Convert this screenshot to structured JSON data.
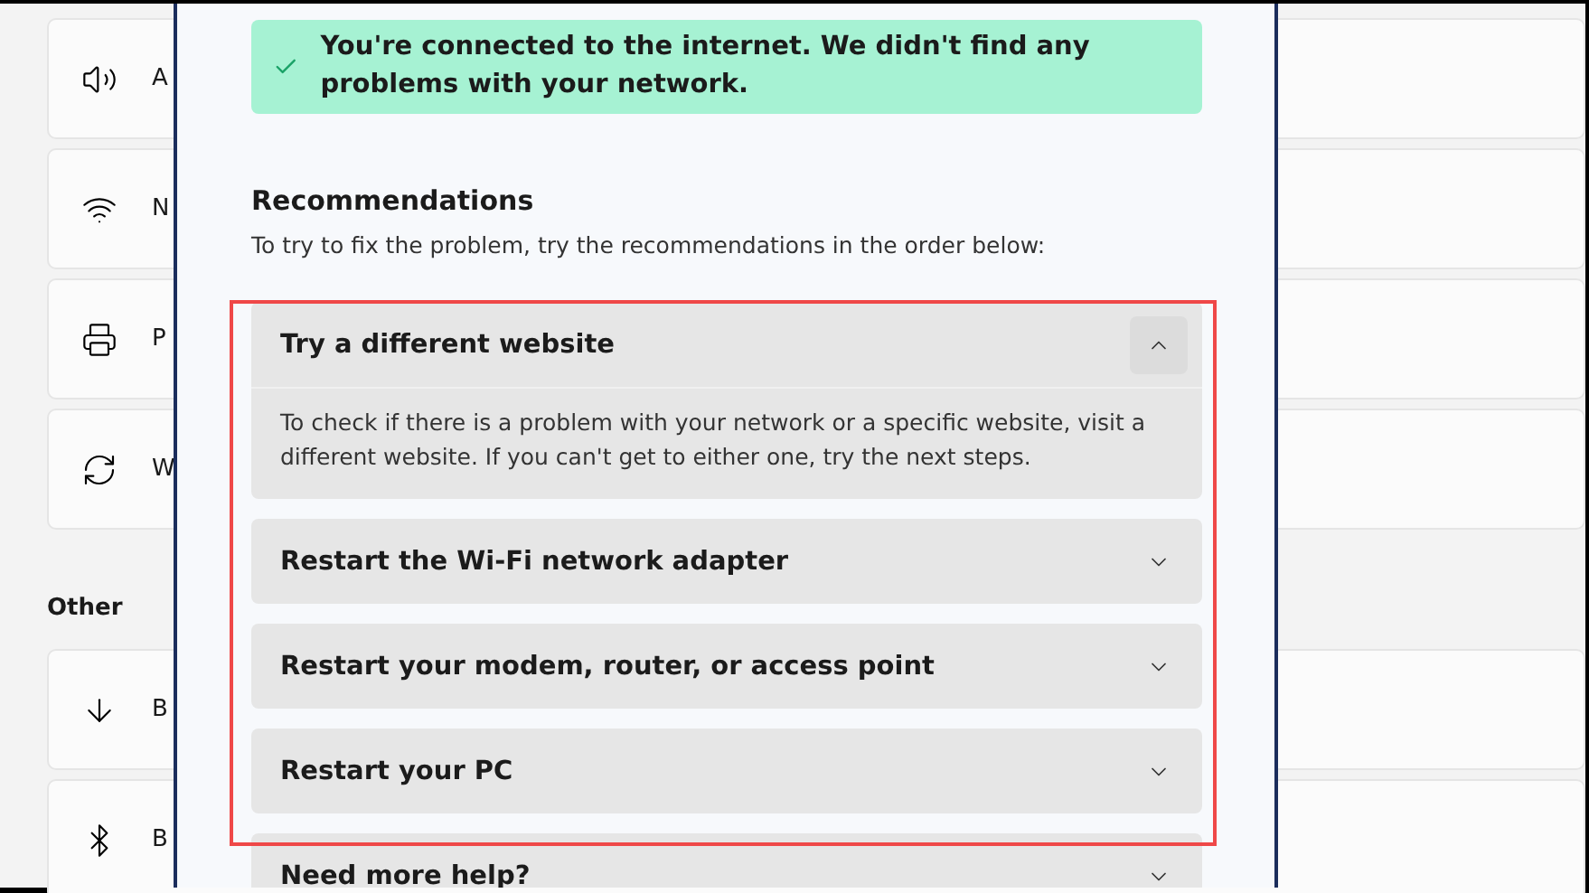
{
  "settings": {
    "cards": [
      {
        "label": "A"
      },
      {
        "label": "N"
      },
      {
        "label": "P"
      },
      {
        "label": "W"
      }
    ],
    "section_title": "Other",
    "other_cards": [
      {
        "label": "B"
      },
      {
        "label": "B"
      }
    ]
  },
  "dialog": {
    "banner": "You're connected to the internet. We didn't find any problems with your network.",
    "heading": "Recommendations",
    "intro": "To try to fix the problem, try the recommendations in the order below:",
    "items": [
      {
        "title": "Try a different website",
        "expanded": true,
        "body": "To check if there is a problem with your network or a specific website, visit a different website. If you can't get to either one, try the next steps."
      },
      {
        "title": "Restart the Wi-Fi network adapter",
        "expanded": false
      },
      {
        "title": "Restart your modem, router, or access point",
        "expanded": false
      },
      {
        "title": "Restart your PC",
        "expanded": false
      },
      {
        "title": "Need more help?",
        "expanded": false
      }
    ]
  }
}
